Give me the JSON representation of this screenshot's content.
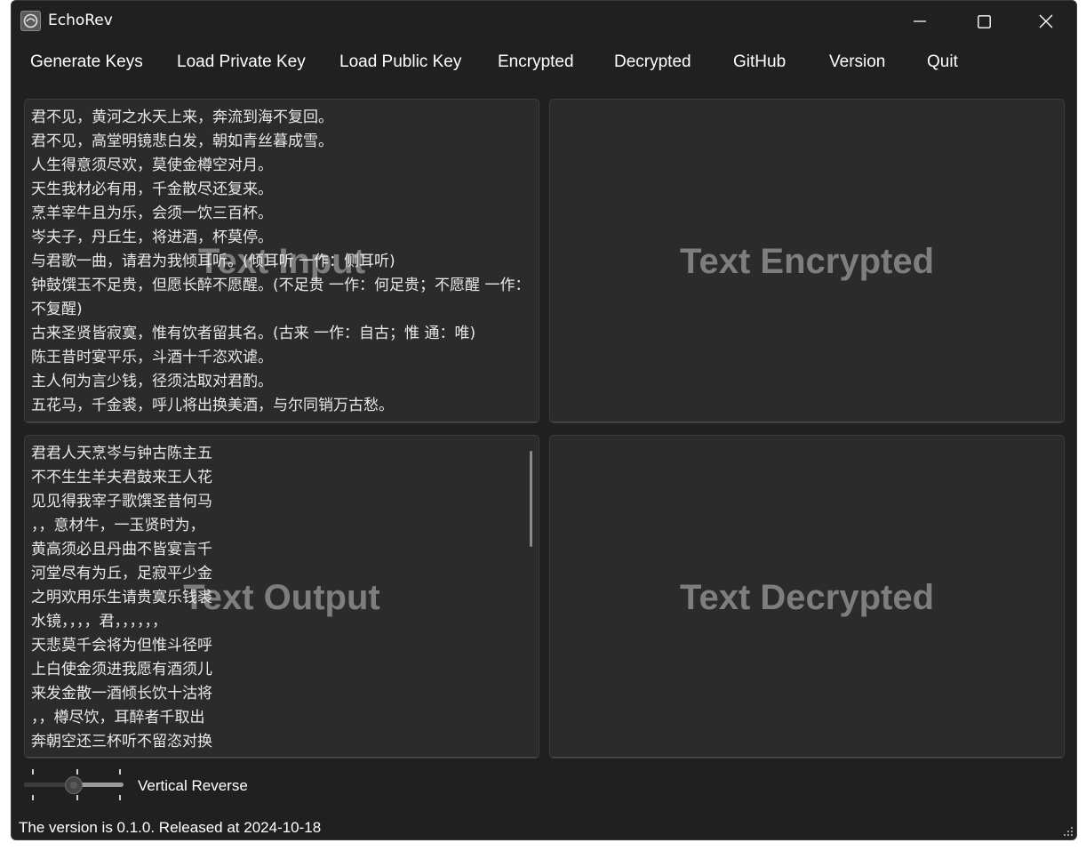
{
  "window": {
    "title": "EchoRev"
  },
  "menu": {
    "generate_keys": "Generate Keys",
    "load_private_key": "Load Private Key",
    "load_public_key": "Load Public Key",
    "encrypted": "Encrypted",
    "decrypted": "Decrypted",
    "github": "GitHub",
    "version": "Version",
    "quit": "Quit"
  },
  "panels": {
    "input": {
      "placeholder": "Text Input",
      "text": "君不见，黄河之水天上来，奔流到海不复回。\n君不见，高堂明镜悲白发，朝如青丝暮成雪。\n人生得意须尽欢，莫使金樽空对月。\n天生我材必有用，千金散尽还复来。\n烹羊宰牛且为乐，会须一饮三百杯。\n岑夫子，丹丘生，将进酒，杯莫停。\n与君歌一曲，请君为我倾耳听。(倾耳听 一作：侧耳听)\n钟鼓馔玉不足贵，但愿长醉不愿醒。(不足贵 一作：何足贵；不愿醒 一作：不复醒)\n古来圣贤皆寂寞，惟有饮者留其名。(古来 一作：自古；惟 通：唯)\n陈王昔时宴平乐，斗酒十千恣欢谑。\n主人何为言少钱，径须沽取对君酌。\n五花马，千金裘，呼儿将出换美酒，与尔同销万古愁。"
    },
    "encrypted": {
      "placeholder": "Text Encrypted"
    },
    "output": {
      "placeholder": "Text Output",
      "text": "君君人天烹岑与钟古陈主五\n不不生生羊夫君鼓来王人花\n见见得我宰子歌馔圣昔何马\n，，意材牛，一玉贤时为，\n黄高须必且丹曲不皆宴言千\n河堂尽有为丘，足寂平少金\n之明欢用乐生请贵寞乐钱裘\n水镜，，，，君，，，，，，\n天悲莫千会将为但惟斗径呼\n上白使金须进我愿有酒须儿\n来发金散一酒倾长饮十沽将\n，，樽尽饮，耳醉者千取出\n奔朝空还三杯听不留恣对换\n流如对复百莫。愿其欢君美"
    },
    "decrypted": {
      "placeholder": "Text Decrypted"
    }
  },
  "slider": {
    "label": "Vertical Reverse",
    "value_fraction": 0.5
  },
  "status": {
    "text": "The version is 0.1.0. Released at 2024-10-18"
  },
  "colors": {
    "background": "#202020",
    "panel": "#2b2b2b",
    "placeholder": "#7e7e7e",
    "text": "#e8e8e8"
  }
}
